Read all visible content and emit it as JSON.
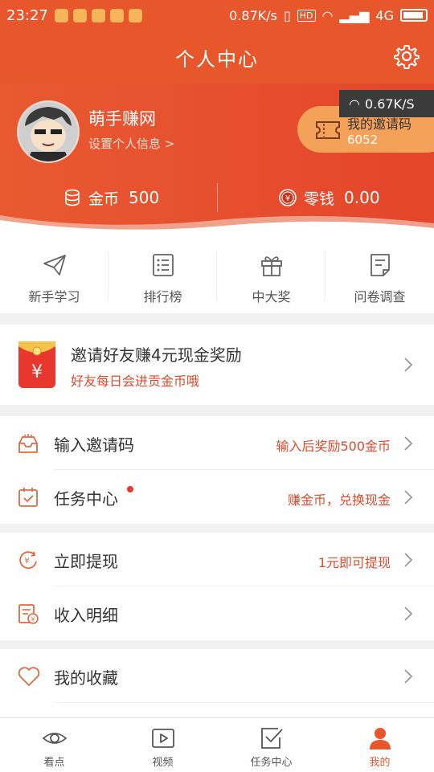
{
  "status_bar": {
    "time": "23:27",
    "net_speed": "0.87K/s",
    "hd": "HD",
    "network": "4G"
  },
  "header": {
    "title": "个人中心",
    "settings_icon": "gear-icon"
  },
  "profile": {
    "name": "萌手赚网",
    "settings_link": "设置个人信息 >",
    "invite_label": "我的邀请码",
    "invite_code": "6052",
    "speed_overlay": "0.67K/S"
  },
  "balance": {
    "coins_label": "金币",
    "coins_value": "500",
    "cash_label": "零钱",
    "cash_value": "0.00"
  },
  "quick_actions": [
    {
      "label": "新手学习",
      "icon": "paper-plane-icon"
    },
    {
      "label": "排行榜",
      "icon": "list-icon"
    },
    {
      "label": "中大奖",
      "icon": "gift-icon"
    },
    {
      "label": "问卷调查",
      "icon": "survey-icon"
    }
  ],
  "banner": {
    "title": "邀请好友赚4元现金奖励",
    "subtitle": "好友每日会进贡金币哦"
  },
  "menu": {
    "invite_code": {
      "label": "输入邀请码",
      "hint": "输入后奖励500金币"
    },
    "task_center": {
      "label": "任务中心",
      "hint": "赚金币，兑换现金"
    },
    "withdraw": {
      "label": "立即提现",
      "hint": "1元即可提现"
    },
    "income": {
      "label": "收入明细"
    },
    "favorites": {
      "label": "我的收藏"
    }
  },
  "tabs": [
    {
      "label": "看点",
      "icon": "eye-icon"
    },
    {
      "label": "视频",
      "icon": "video-icon"
    },
    {
      "label": "任务中心",
      "icon": "task-check-icon"
    },
    {
      "label": "我的",
      "icon": "person-icon"
    }
  ],
  "colors": {
    "brand": "#e8562c",
    "accent_red": "#e04a2d",
    "invite_pill": "#f4a25a"
  }
}
